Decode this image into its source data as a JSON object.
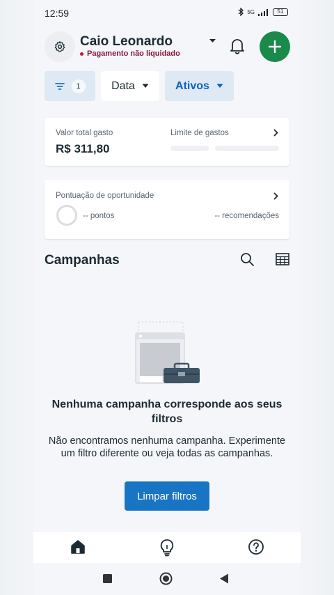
{
  "status_bar": {
    "time": "12:59",
    "network": "5G",
    "battery": "51"
  },
  "header": {
    "account_name": "Caio Leonardo",
    "account_status": "Pagamento não liquidado",
    "settings_icon": "gear-icon",
    "notifications_icon": "bell-icon",
    "add_icon": "plus-icon"
  },
  "filters": {
    "filter_count": "1",
    "date_label": "Data",
    "status_label": "Ativos"
  },
  "spend_card": {
    "total_label": "Valor total gasto",
    "total_value": "R$ 311,80",
    "limit_label": "Limite de gastos"
  },
  "score_card": {
    "title": "Pontuação de oportunidade",
    "points_text": "-- pontos",
    "recommendations_text": "-- recomendações"
  },
  "campaigns": {
    "title": "Campanhas",
    "empty_title": "Nenhuma campanha corresponde aos seus filtros",
    "empty_description": "Não encontramos nenhuma campanha. Experimente um filtro diferente ou veja todas as campanhas.",
    "clear_button": "Limpar filtros"
  },
  "tabbar": [
    "home-icon",
    "lightbulb-icon",
    "help-icon"
  ],
  "colors": {
    "primary_blue": "#1a74c4",
    "active_chip_text": "#0a61c4",
    "add_button_green": "#1a8a4a",
    "warning_red": "#c01d38"
  }
}
